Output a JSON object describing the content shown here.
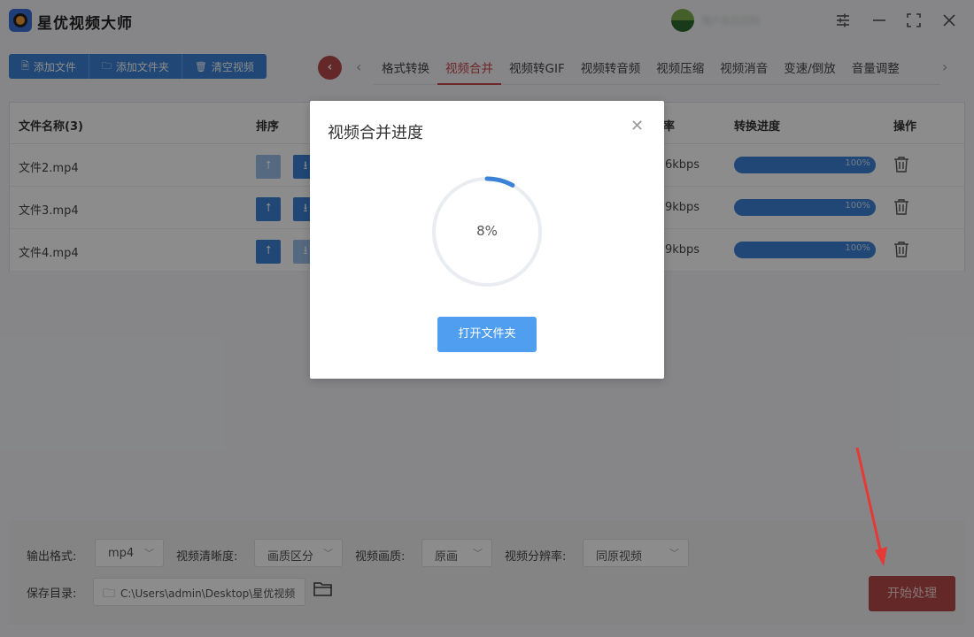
{
  "app": {
    "title": "星优视频大师",
    "user_name": "用户名已打码"
  },
  "toolbar": {
    "add_file": "添加文件",
    "add_folder": "添加文件夹",
    "clear_videos": "清空视频"
  },
  "tabs": [
    {
      "label": "格式转换",
      "active": false
    },
    {
      "label": "视频合并",
      "active": true
    },
    {
      "label": "视频转GIF",
      "active": false
    },
    {
      "label": "视频转音频",
      "active": false
    },
    {
      "label": "视频压缩",
      "active": false
    },
    {
      "label": "视频消音",
      "active": false
    },
    {
      "label": "变速/倒放",
      "active": false
    },
    {
      "label": "音量调整",
      "active": false
    }
  ],
  "table": {
    "headers": {
      "file_name": "文件名称(3)",
      "sort": "排序",
      "bitrate_tail": "率",
      "progress": "转换进度",
      "actions": "操作"
    },
    "rows": [
      {
        "name": "文件2.mp4",
        "bitrate": "6kbps",
        "progress_label": "100%",
        "progress": 1.0,
        "up_enabled": false,
        "down_enabled": true
      },
      {
        "name": "文件3.mp4",
        "bitrate": "9kbps",
        "progress_label": "100%",
        "progress": 1.0,
        "up_enabled": true,
        "down_enabled": true
      },
      {
        "name": "文件4.mp4",
        "bitrate": "9kbps",
        "progress_label": "100%",
        "progress": 1.0,
        "up_enabled": true,
        "down_enabled": false
      }
    ]
  },
  "settings": {
    "output_format_label": "输出格式:",
    "output_format": "mp4",
    "clarity_label": "视频清晰度:",
    "clarity": "画质区分",
    "quality_label": "视频画质:",
    "quality": "原画",
    "resolution_label": "视频分辨率:",
    "resolution": "同原视频",
    "save_dir_label": "保存目录:",
    "save_dir": "C:\\Users\\admin\\Desktop\\星优视频",
    "start_button": "开始处理"
  },
  "modal": {
    "title": "视频合并进度",
    "progress_text": "8%",
    "progress": 0.08,
    "open_folder_button": "打开文件夹"
  },
  "colors": {
    "primary": "#3b82d6",
    "accent_red": "#c8454a",
    "ring_track": "#e9edf2",
    "ring_fill": "#3b82d6"
  }
}
